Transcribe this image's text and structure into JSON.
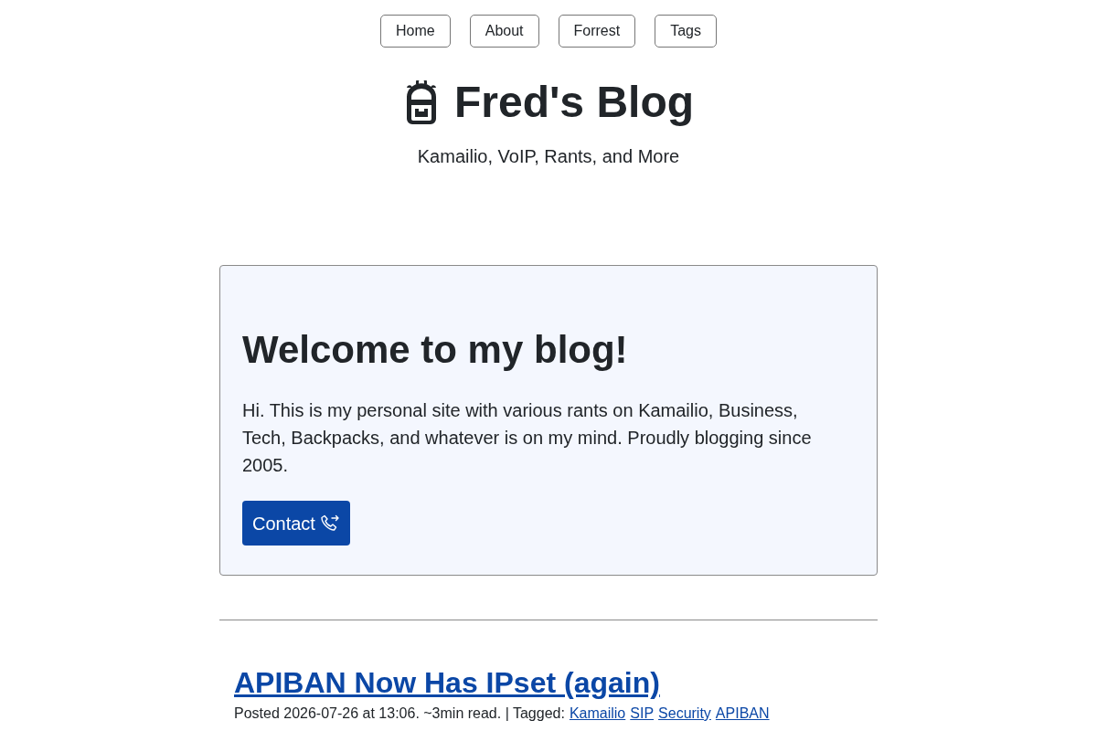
{
  "nav": [
    "Home",
    "About",
    "Forrest",
    "Tags"
  ],
  "header": {
    "title": "Fred's Blog",
    "subtitle": "Kamailio, VoIP, Rants, and More"
  },
  "intro": {
    "heading": "Welcome to my blog!",
    "text": "Hi. This is my personal site with various rants on Kamailio, Business, Tech, Backpacks, and whatever is on my mind. Proudly blogging since 2005.",
    "button": "Contact"
  },
  "posts": [
    {
      "title": "APIBAN Now Has IPset (again)",
      "meta": "Posted 2026-07-26 at 13:06. ~3min read. | Tagged:",
      "tags": [
        "Kamailio",
        "SIP",
        "Security",
        "APIBAN"
      ]
    }
  ]
}
